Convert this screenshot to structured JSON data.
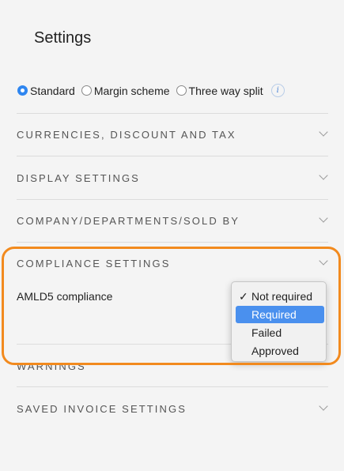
{
  "page": {
    "title": "Settings"
  },
  "scheme": {
    "options": [
      {
        "label": "Standard",
        "checked": true
      },
      {
        "label": "Margin scheme",
        "checked": false
      },
      {
        "label": "Three way split",
        "checked": false
      }
    ],
    "info_icon": "info-icon",
    "info_glyph": "i"
  },
  "sections": {
    "currencies": "CURRENCIES, DISCOUNT AND TAX",
    "display": "DISPLAY SETTINGS",
    "company": "COMPANY/DEPARTMENTS/SOLD BY",
    "compliance": "COMPLIANCE SETTINGS",
    "warnings": "WARNINGS",
    "saved_invoice": "SAVED INVOICE SETTINGS"
  },
  "compliance": {
    "aml_label": "AMLD5 compliance",
    "dropdown": {
      "options": [
        "Not required",
        "Required",
        "Failed",
        "Approved"
      ],
      "checked_option": "Not required",
      "highlighted_option": "Required",
      "check_glyph": "✓"
    }
  },
  "colors": {
    "accent": "#2f86f0",
    "highlight_border": "#f28a1e",
    "menu_highlight": "#4a90ee"
  }
}
